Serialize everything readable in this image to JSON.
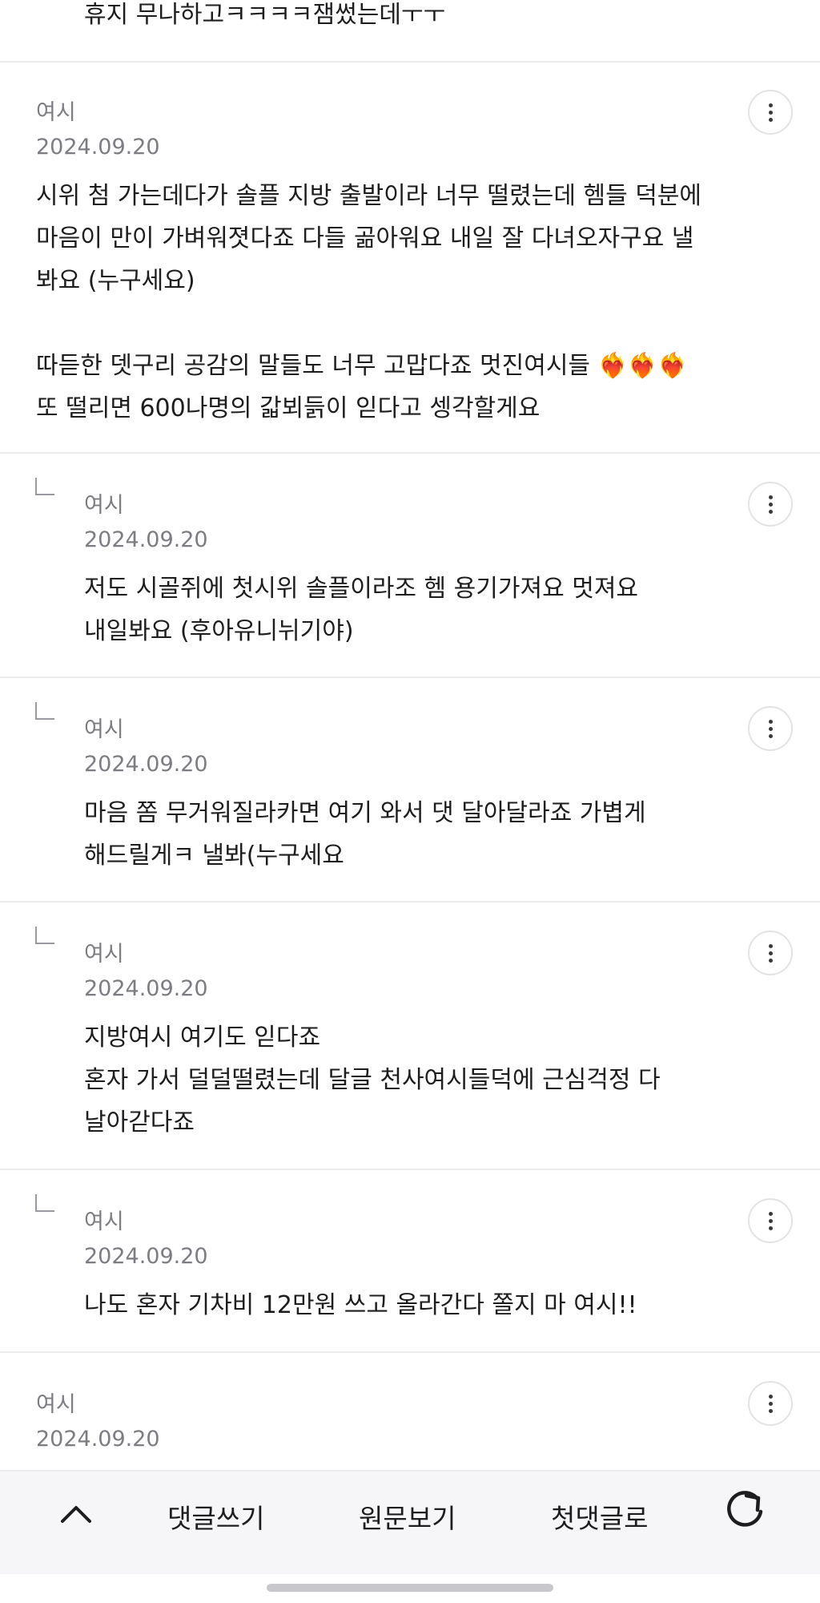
{
  "top_text": "휴지 무나하고ㅋㅋㅋㅋ잼썼는데ㅜㅜ",
  "comments": [
    {
      "author": "여시",
      "date": "2024.09.20",
      "body": "시위 첨 가는데다가 솔플 지방 출발이라 너무 떨렸는데 헴들 덕분에\n마음이 만이 가벼워졋다죠 다들 곪아워요 내일 잘 다녀오자구요 낼\n봐요 (누구세요)\n\n따듣한 뎃구리 공감의 말들도 너무 고맙다죠 멋진여시들 ❤️‍🔥❤️‍🔥❤️‍🔥\n또 떨리면 600나명의 갋뵈듥이 읻다고 셍각할게요"
    },
    {
      "author": "여시",
      "date": "2024.09.20",
      "body": "저도 시골쥐에 첫시위 솔플이라조 헴 용기가져요 멋져요\n내일봐요 (후아유니뉘기야)"
    },
    {
      "author": "여시",
      "date": "2024.09.20",
      "body": "마음 쫌 무거워질라카면 여기 와서 댓 달아달라죠 가볍게\n해드릴게ㅋ 낼봐(누구세요"
    },
    {
      "author": "여시",
      "date": "2024.09.20",
      "body": "지방여시 여기도 읻다죠\n혼자 가서 덜덜떨렸는데 달글 천사여시들덕에 근심걱정 다\n날아갇다죠"
    },
    {
      "author": "여시",
      "date": "2024.09.20",
      "body": "나도 혼자 기차비 12만원 쓰고 올라간다 쫄지 마 여시!!"
    },
    {
      "author": "여시",
      "date": "2024.09.20",
      "body": ""
    }
  ],
  "bottom_bar": {
    "up_icon": "chevron-up-icon",
    "write_comment": "댓글쓰기",
    "view_original": "원문보기",
    "first_comment": "첫댓글로",
    "refresh_icon": "refresh-icon"
  }
}
